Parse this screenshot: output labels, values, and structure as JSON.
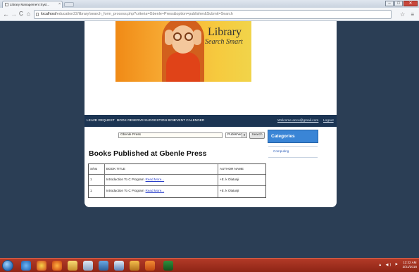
{
  "browser": {
    "tab_title": "Library Management Syst...",
    "tab_close": "×",
    "url_host": "localhost",
    "url_path": "/education22/library/search_form_process.php?criteria=Gbenle+Press&option=publisher&Submit=Search",
    "window_controls": {
      "minimize": "–",
      "maximize": "□",
      "close": "✕"
    },
    "nav_icons": [
      "back-arrow-icon",
      "forward-arrow-icon",
      "reload-icon",
      "home-icon"
    ]
  },
  "banner": {
    "logo_line1": "Library",
    "logo_line2": "Search Smart"
  },
  "menu": {
    "items": [
      "LEAVE REQUEST",
      "BOOK RESERVE",
      "SUGGESTION BOX",
      "EVENT CALENDER"
    ],
    "welcome": "Welcome ancu@gmail.com",
    "logout": "Logout"
  },
  "search": {
    "value": "Gbenle Press",
    "option": "Publisher",
    "button": "Search"
  },
  "results": {
    "heading": "Books Published at Gbenle Press",
    "columns": [
      "S/No",
      "BOOK TITLE",
      "AUTHOR NAME"
    ],
    "rows": [
      {
        "sn": "1",
        "title": "Introduction To C Program",
        "link": "Read More...",
        "author": "+E. k Olatunji"
      },
      {
        "sn": "1",
        "title": "Introduction To C Program",
        "link": "Read More...",
        "author": "+E. k Olatunji"
      }
    ]
  },
  "sidebar": {
    "title": "Categories",
    "links": [
      "Computing"
    ]
  },
  "taskbar": {
    "time": "12:22 AM",
    "date": "3/31/2016",
    "tray": "▲ ◀) ⚑"
  },
  "colors": {
    "page_background": "#2b3e55",
    "menu_bar": "#1c3553",
    "categories_header": "#3a85d6",
    "link": "#2a3fc9",
    "taskbar": "#a22f1e"
  }
}
